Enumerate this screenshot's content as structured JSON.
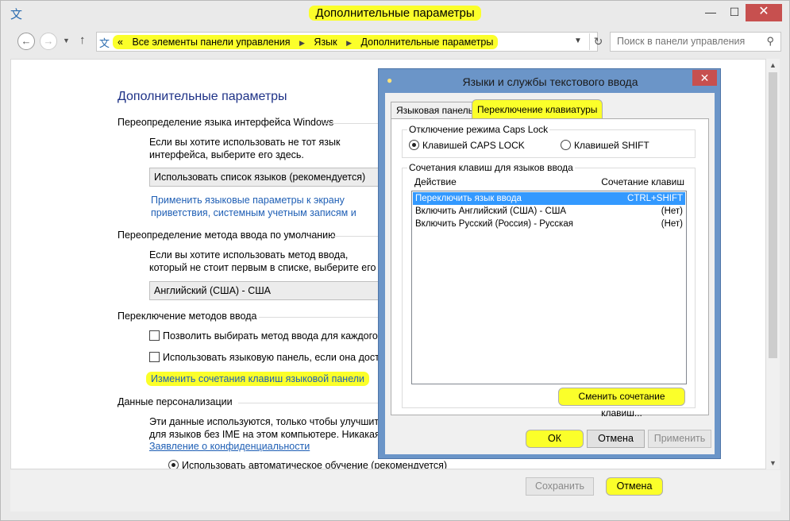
{
  "window": {
    "title": "Дополнительные параметры",
    "min_glyph": "—",
    "max_glyph": "☐",
    "close_glyph": "✕"
  },
  "nav": {
    "back_glyph": "←",
    "forward_glyph": "→",
    "history_glyph": "▼",
    "up_glyph": "↑",
    "breadcrumb_prefix": "«",
    "breadcrumbs": [
      "Все элементы панели управления",
      "Язык",
      "Дополнительные параметры"
    ],
    "crumb_separator": "▶",
    "dropdown_glyph": "▼",
    "refresh_glyph": "↻",
    "search_placeholder": "Поиск в панели управления"
  },
  "main": {
    "page_title": "Дополнительные параметры",
    "ui_override": {
      "title": "Переопределение языка интерфейса Windows",
      "desc": "Если вы хотите использовать не тот язык интерфейса, выберите его здесь.",
      "combo": "Использовать список языков (рекомендуется)",
      "link": "Применить языковые параметры к экрану приветствия, системным учетным записям и новым учетным записям пользователей"
    },
    "input_override": {
      "title": "Переопределение метода ввода по умолчанию",
      "desc": "Если вы хотите использовать метод ввода, который не стоит первым в списке, выберите его здесь.",
      "combo": "Английский (США) - США"
    },
    "switching": {
      "title": "Переключение методов ввода",
      "check1": "Позволить выбирать метод ввода для каждого приложения",
      "check2": "Использовать языковую панель, если она доступна",
      "link": "Изменить сочетания клавиш языковой панели"
    },
    "personalization": {
      "title": "Данные персонализации",
      "desc1": "Эти данные используются, только чтобы улучшить распознавание рукописного ввода",
      "desc2": "для языков без IME на этом компьютере. Никакая информация не отправляется.",
      "link": "Заявление о конфиденциальности",
      "radio": "Использовать автоматическое обучение (рекомендуется)"
    }
  },
  "footer": {
    "save_label": "Сохранить",
    "cancel_label": "Отмена"
  },
  "dialog": {
    "title": "Языки и службы текстового ввода",
    "close_glyph": "✕",
    "tabs": [
      "Языковая панель",
      "Переключение клавиатуры"
    ],
    "caps_group": {
      "label": "Отключение режима Caps Lock",
      "option_caps": "Клавишей CAPS LOCK",
      "option_shift": "Клавишей SHIFT"
    },
    "hotkeys_group": {
      "label": "Сочетания клавиш для языков ввода",
      "col_action": "Действие",
      "col_keys": "Сочетание клавиш",
      "rows": [
        {
          "action": "Переключить язык ввода",
          "keys": "CTRL+SHIFT"
        },
        {
          "action": "Включить Английский (США) - США",
          "keys": "(Нет)"
        },
        {
          "action": "Включить Русский (Россия) - Русская",
          "keys": "(Нет)"
        }
      ],
      "change_button": "Сменить сочетание клавиш..."
    },
    "ok_label": "ОК",
    "cancel_label": "Отмена",
    "apply_label": "Применить"
  },
  "scrollbar": {
    "up_glyph": "▲",
    "down_glyph": "▼"
  }
}
